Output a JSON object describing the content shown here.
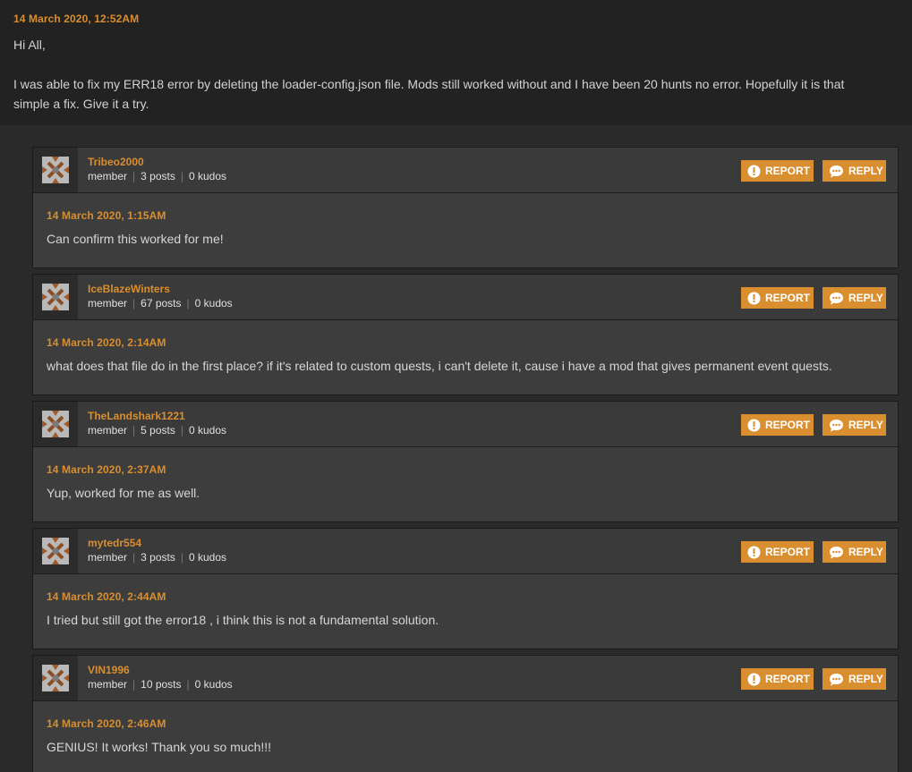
{
  "parent": {
    "date": "14 March 2020, 12:52AM",
    "greeting": "Hi All,",
    "line1": "I was able to fix my ERR18 error by deleting the loader-config.json file. Mods still worked without and I have been 20 hunts no error. Hopefully it is that",
    "line2": "simple a fix. Give it a try."
  },
  "labels": {
    "report": "REPORT",
    "reply": "REPLY"
  },
  "colors": {
    "accent": "#d98e2f",
    "page_bg": "#222222",
    "card_bg": "#3d3d3d"
  },
  "replies": [
    {
      "author": "Tribeo2000",
      "role": "member",
      "posts": "3 posts",
      "kudos": "0 kudos",
      "date": "14 March 2020, 1:15AM",
      "text": "Can confirm this worked for me!"
    },
    {
      "author": "IceBlazeWinters",
      "role": "member",
      "posts": "67 posts",
      "kudos": "0 kudos",
      "date": "14 March 2020, 2:14AM",
      "text": "what does that file do in the first place? if it's related to custom quests, i can't delete it, cause i have a mod that gives permanent event quests."
    },
    {
      "author": "TheLandshark1221",
      "role": "member",
      "posts": "5 posts",
      "kudos": "0 kudos",
      "date": "14 March 2020, 2:37AM",
      "text": "Yup, worked for me as well."
    },
    {
      "author": "mytedr554",
      "role": "member",
      "posts": "3 posts",
      "kudos": "0 kudos",
      "date": "14 March 2020, 2:44AM",
      "text": "I tried but still got the error18 , i think this is not a fundamental solution."
    },
    {
      "author": "VIN1996",
      "role": "member",
      "posts": "10 posts",
      "kudos": "0 kudos",
      "date": "14 March 2020, 2:46AM",
      "text": "GENIUS! It works! Thank you so much!!!"
    }
  ]
}
